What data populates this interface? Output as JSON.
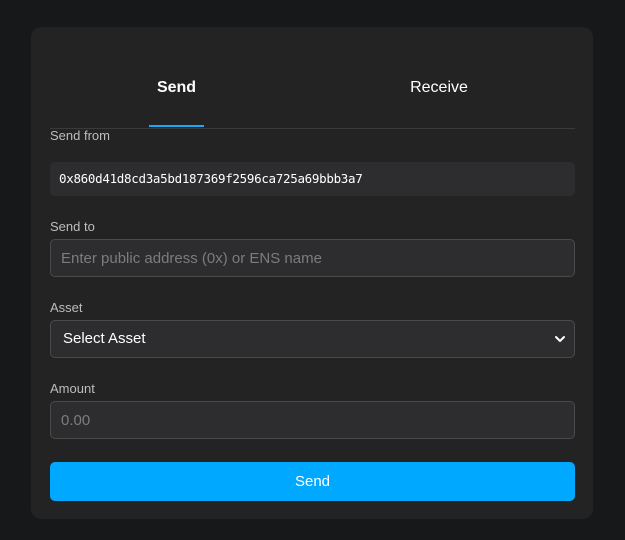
{
  "tabs": {
    "send": "Send",
    "receive": "Receive",
    "active": "send"
  },
  "form": {
    "send_from": {
      "label": "Send from",
      "value": "0x860d41d8cd3a5bd187369f2596ca725a69bbb3a7"
    },
    "send_to": {
      "label": "Send to",
      "value": "",
      "placeholder": "Enter public address (0x) or ENS name"
    },
    "asset": {
      "label": "Asset",
      "selected": "Select Asset"
    },
    "amount": {
      "label": "Amount",
      "value": "",
      "placeholder": "0.00"
    }
  },
  "submit_label": "Send",
  "icons": {
    "asset_dropdown": "chevron-down-icon"
  },
  "colors": {
    "accent": "#00a8ff",
    "tab_indicator": "#1aa9f5",
    "card_background": "#232324",
    "page_background": "#17181a"
  }
}
